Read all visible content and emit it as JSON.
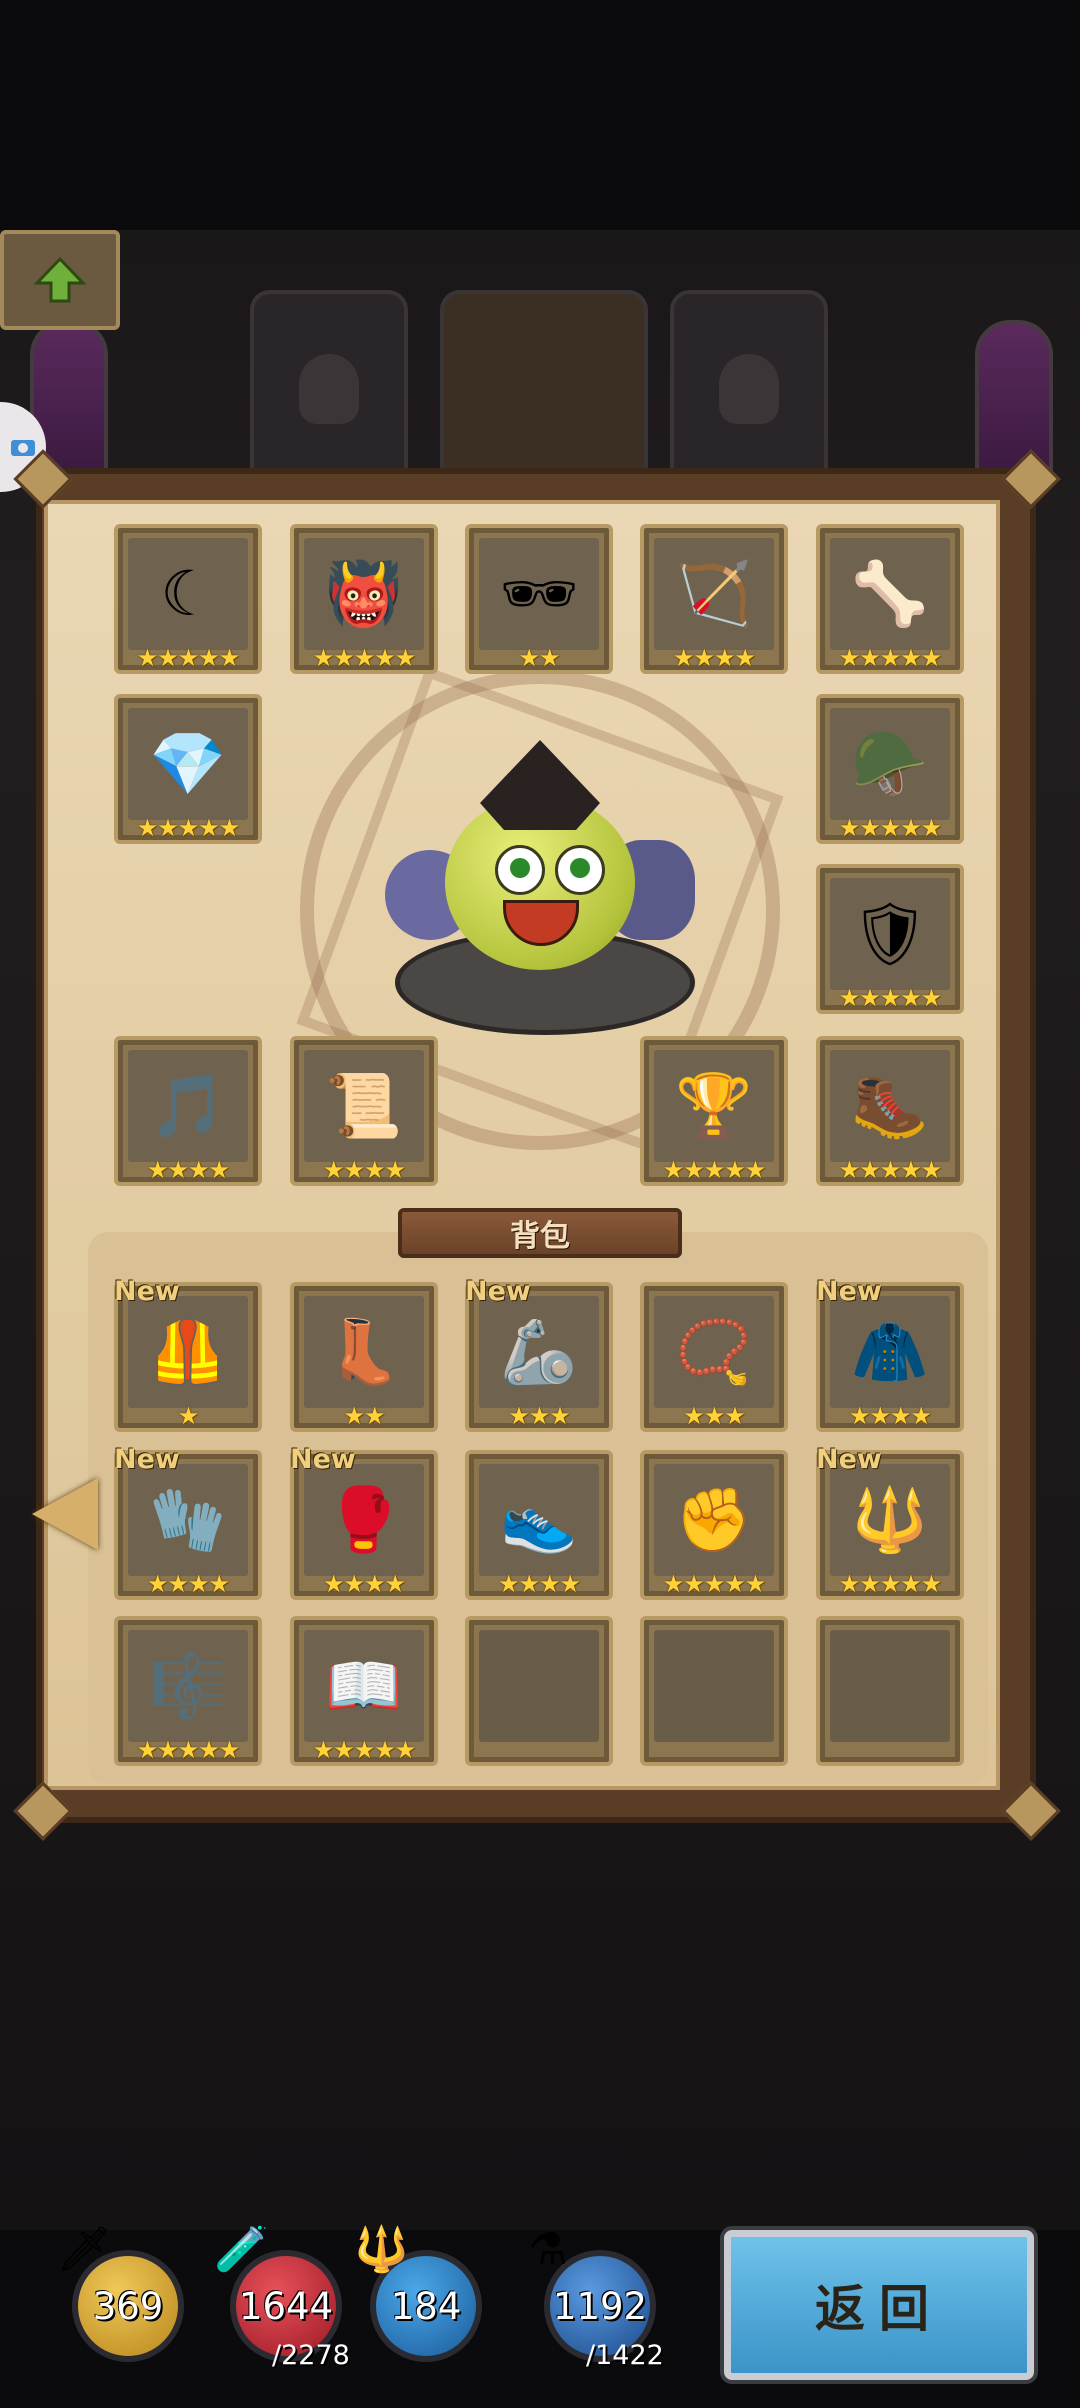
{
  "equipped": [
    {
      "icon": "☾",
      "stars": "★★★★★"
    },
    {
      "icon": "👹",
      "stars": "★★★★★"
    },
    {
      "icon": "🕶",
      "stars": "★★"
    },
    {
      "icon": "🏹",
      "stars": "★★★★"
    },
    {
      "icon": "🦴",
      "stars": "★★★★★"
    },
    {
      "icon": "💎",
      "stars": "★★★★★"
    },
    {
      "icon": "🪖",
      "stars": "★★★★★"
    },
    {
      "icon": "🛡",
      "stars": "★★★★★"
    },
    {
      "icon": "🎵",
      "stars": "★★★★"
    },
    {
      "icon": "📜",
      "stars": "★★★★"
    },
    {
      "icon": "🏆",
      "stars": "★★★★★"
    },
    {
      "icon": "🥾",
      "stars": "★★★★★"
    }
  ],
  "bag_tab_label": "背包",
  "bag": [
    {
      "icon": "🦺",
      "stars": "★",
      "new": "New"
    },
    {
      "icon": "👢",
      "stars": "★★",
      "new": ""
    },
    {
      "icon": "🦾",
      "stars": "★★★",
      "new": "New"
    },
    {
      "icon": "📿",
      "stars": "★★★",
      "new": ""
    },
    {
      "icon": "🧥",
      "stars": "★★★★",
      "new": "New"
    },
    {
      "icon": "🧤",
      "stars": "★★★★",
      "new": "New"
    },
    {
      "icon": "🥊",
      "stars": "★★★★",
      "new": "New"
    },
    {
      "icon": "👟",
      "stars": "★★★★",
      "new": ""
    },
    {
      "icon": "✊",
      "stars": "★★★★★",
      "new": ""
    },
    {
      "icon": "🔱",
      "stars": "★★★★★",
      "new": "New"
    },
    {
      "icon": "🎼",
      "stars": "★★★★★",
      "new": ""
    },
    {
      "icon": "📖",
      "stars": "★★★★★",
      "new": ""
    }
  ],
  "resources": [
    {
      "icon": "🗡",
      "value": "369",
      "max": "",
      "color": "#d6a93a"
    },
    {
      "icon": "🧪",
      "value": "1644",
      "max": "/2278",
      "color": "#c8303a"
    },
    {
      "icon": "🔱",
      "value": "184",
      "max": "",
      "color": "#2a7fc9"
    },
    {
      "icon": "⚗",
      "value": "1192",
      "max": "/1422",
      "color": "#2f6fb8"
    }
  ],
  "back_label": "返回"
}
